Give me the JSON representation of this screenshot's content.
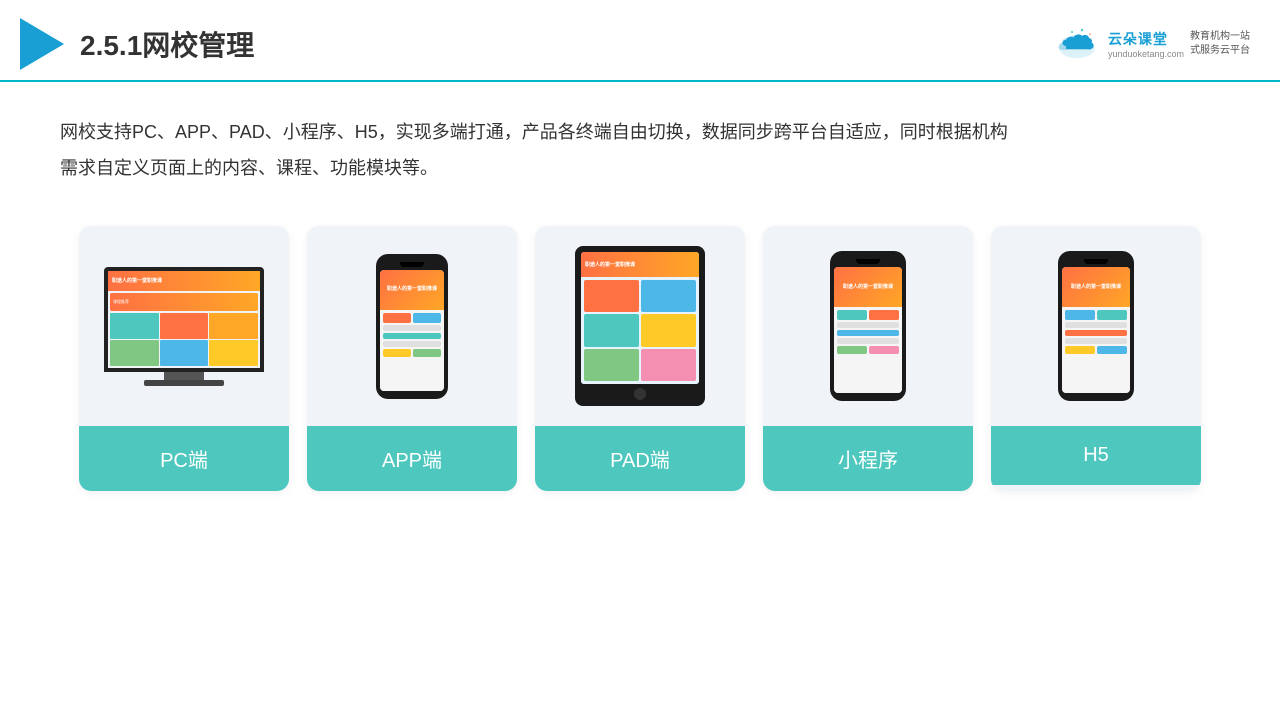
{
  "header": {
    "title": "2.5.1网校管理",
    "logo": {
      "name": "云朵课堂",
      "url": "yunduoketang.com",
      "slogan_line1": "教育机构一站",
      "slogan_line2": "式服务云平台"
    }
  },
  "description": "网校支持PC、APP、PAD、小程序、H5，实现多端打通，产品各终端自由切换，数据同步跨平台自适应，同时根据机构",
  "description2": "需求自定义页面上的内容、课程、功能模块等。",
  "cards": [
    {
      "id": "pc",
      "label": "PC端",
      "type": "pc"
    },
    {
      "id": "app",
      "label": "APP端",
      "type": "phone"
    },
    {
      "id": "pad",
      "label": "PAD端",
      "type": "tablet"
    },
    {
      "id": "miniprogram",
      "label": "小程序",
      "type": "phone"
    },
    {
      "id": "h5",
      "label": "H5",
      "type": "phone"
    }
  ],
  "accent_color": "#4ec8be",
  "title_color": "#333333"
}
